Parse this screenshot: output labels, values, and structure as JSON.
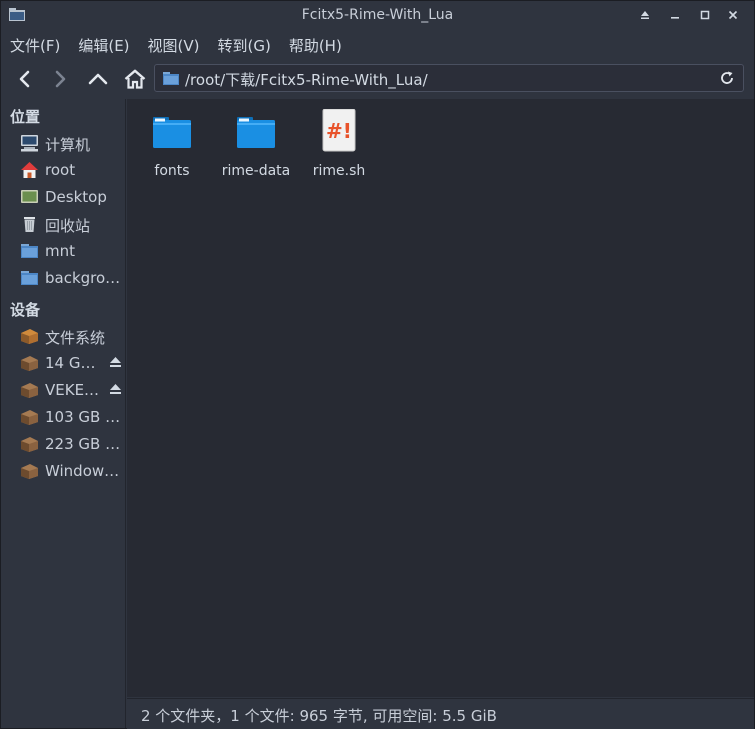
{
  "window": {
    "title": "Fcitx5-Rime-With_Lua"
  },
  "menu": [
    {
      "label": "文件(F)"
    },
    {
      "label": "编辑(E)"
    },
    {
      "label": "视图(V)"
    },
    {
      "label": "转到(G)"
    },
    {
      "label": "帮助(H)"
    }
  ],
  "toolbar": {
    "back_icon": "arrow-left-icon",
    "forward_icon": "arrow-right-icon",
    "up_icon": "arrow-up-icon",
    "home_icon": "home-icon",
    "path": "/root/下载/Fcitx5-Rime-With_Lua/"
  },
  "sidebar": {
    "places_title": "位置",
    "places": [
      {
        "label": "计算机",
        "icon": "computer-icon"
      },
      {
        "label": "root",
        "icon": "home-icon"
      },
      {
        "label": "Desktop",
        "icon": "desktop-icon"
      },
      {
        "label": "回收站",
        "icon": "trash-icon"
      },
      {
        "label": "mnt",
        "icon": "folder-icon"
      },
      {
        "label": "backgro…",
        "icon": "folder-icon"
      }
    ],
    "devices_title": "设备",
    "devices": [
      {
        "label": "文件系统",
        "icon": "drive-icon",
        "eject": false
      },
      {
        "label": "14 G…",
        "icon": "drive-icon",
        "eject": true
      },
      {
        "label": "VEKE…",
        "icon": "drive-icon",
        "eject": true
      },
      {
        "label": "103 GB …",
        "icon": "drive-icon",
        "eject": false
      },
      {
        "label": "223 GB …",
        "icon": "drive-icon",
        "eject": false
      },
      {
        "label": "Window…",
        "icon": "drive-icon",
        "eject": false
      }
    ]
  },
  "files": [
    {
      "name": "fonts",
      "type": "folder"
    },
    {
      "name": "rime-data",
      "type": "folder"
    },
    {
      "name": "rime.sh",
      "type": "script",
      "glyph": "#!"
    }
  ],
  "status": "2 个文件夹，1 个文件: 965 字节, 可用空间: 5.5 GiB",
  "colors": {
    "folder": "#1a8fe3",
    "folder_tab": "#5fc0ff",
    "script_glyph": "#e8532b",
    "background": "#2f343f",
    "view": "#272a33"
  }
}
